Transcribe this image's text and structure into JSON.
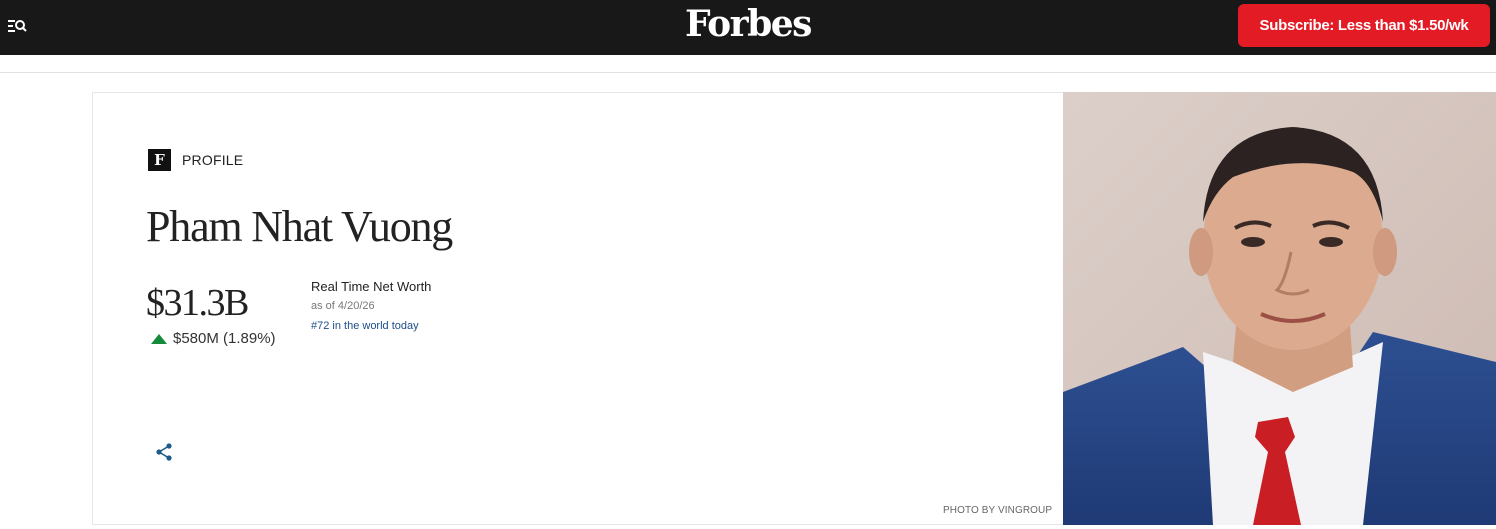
{
  "header": {
    "logo": "Forbes",
    "subscribe_label": "Subscribe: Less than $1.50/wk",
    "menu_icon": "menu-search-icon"
  },
  "profile": {
    "badge_letter": "F",
    "badge_label": "PROFILE",
    "name": "Pham Nhat Vuong",
    "net_worth": "$31.3B",
    "change": "$580M (1.89%)",
    "change_direction": "up",
    "real_time_label": "Real Time Net Worth",
    "as_of": "as of 4/20/26",
    "rank": "#72 in the world today",
    "share_icon": "share-icon",
    "photo_credit": "PHOTO BY VINGROUP"
  },
  "colors": {
    "header_bg": "#181818",
    "subscribe_red": "#e21b25",
    "up_green": "#148a3b",
    "link_blue": "#1d4e89"
  }
}
